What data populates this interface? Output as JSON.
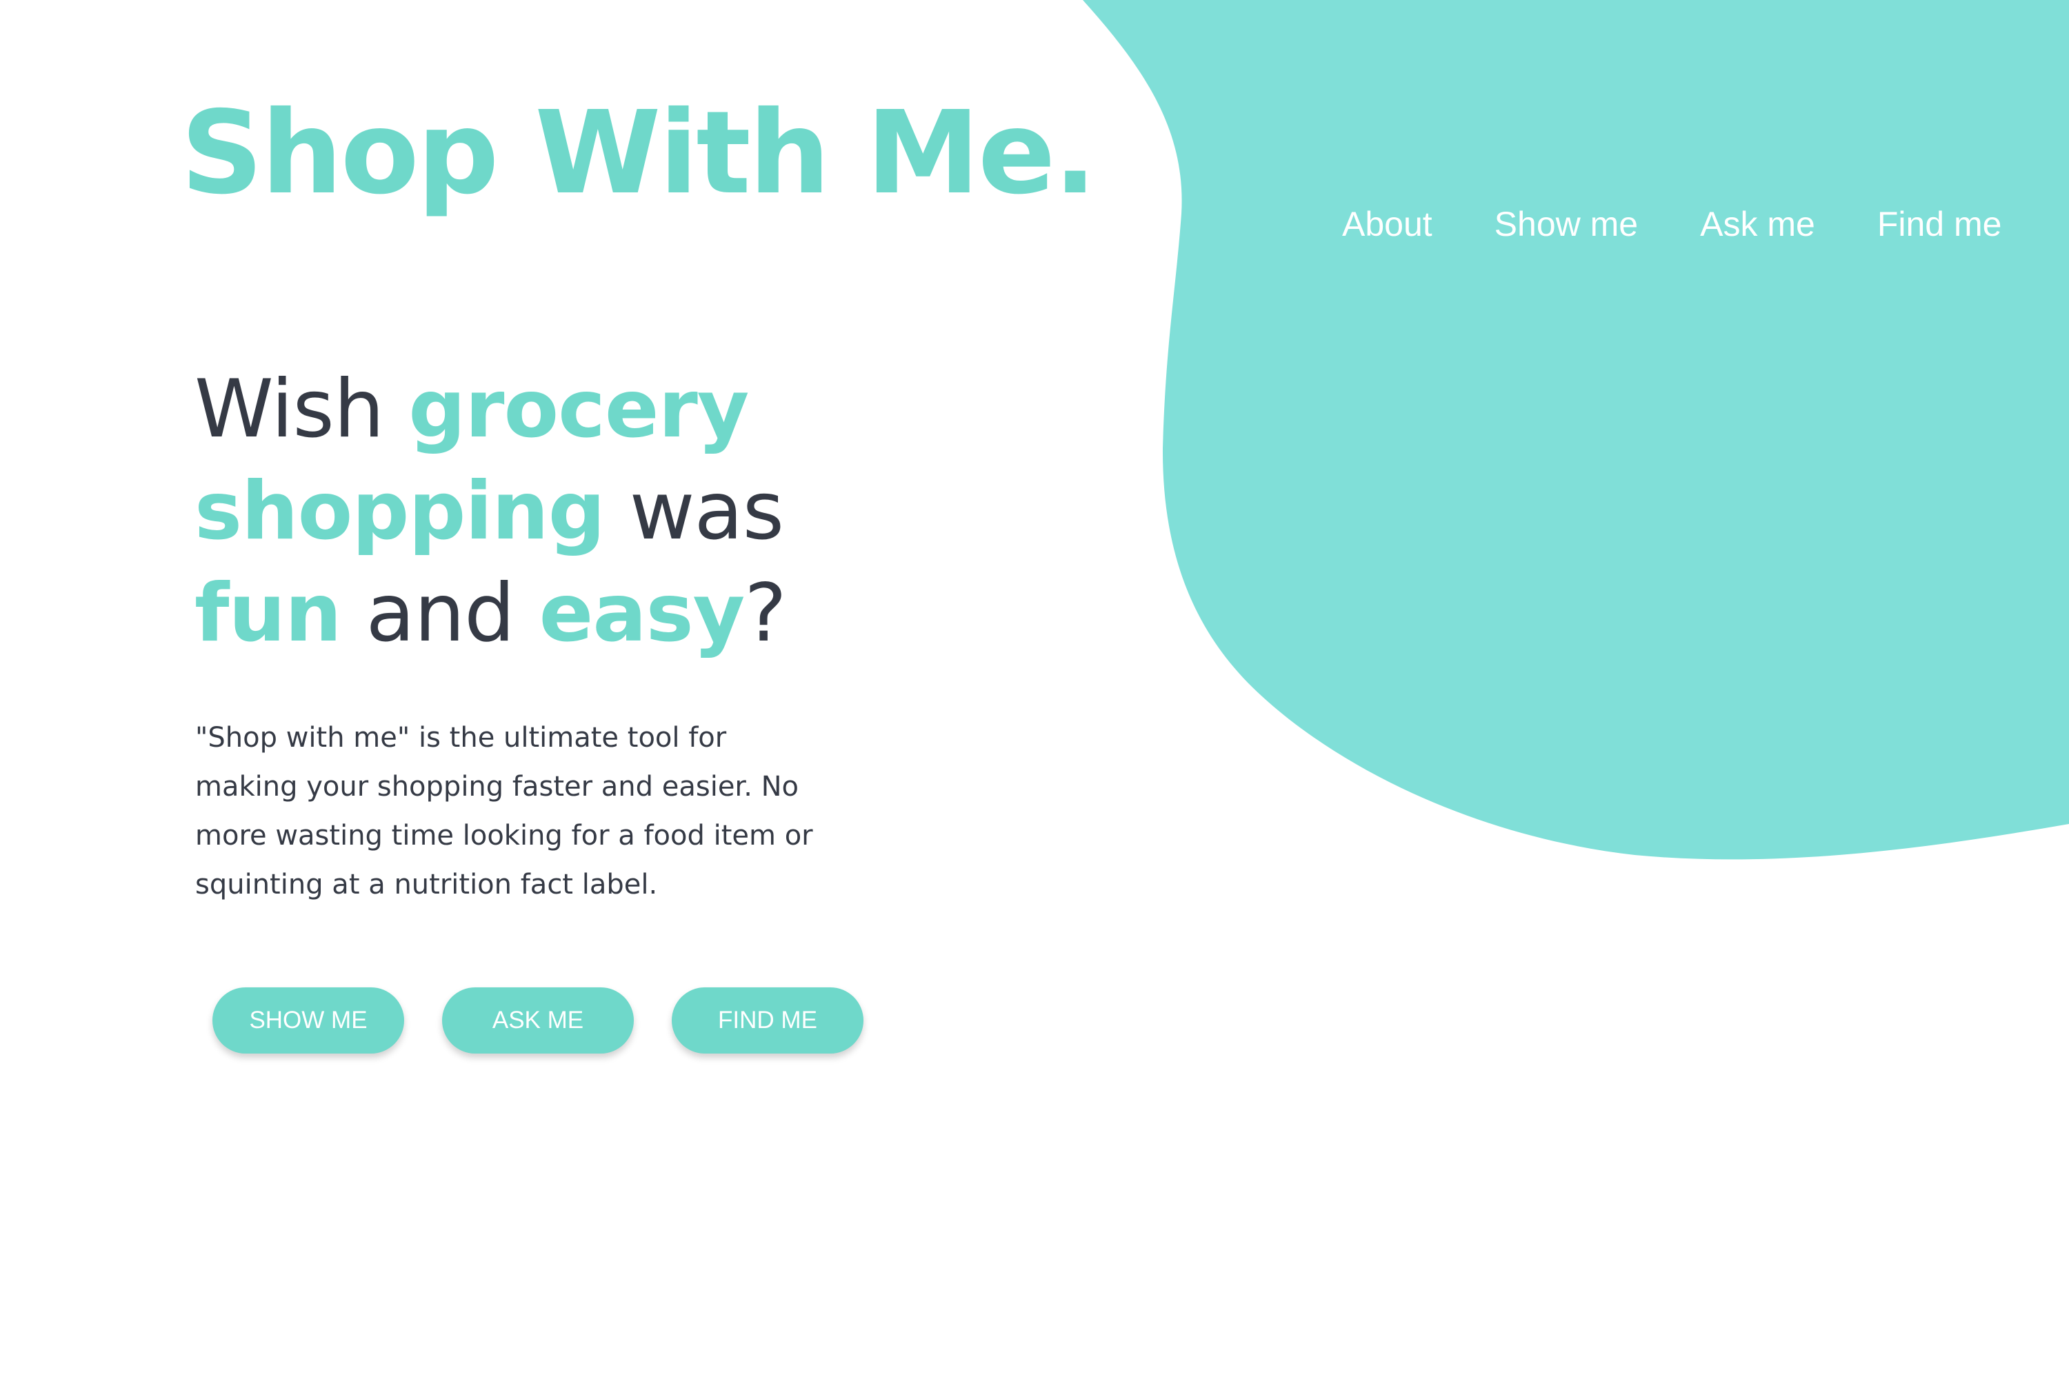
{
  "brand": {
    "name": "Shop With Me.",
    "accent_color": "#6fd8ca",
    "blob_color": "#80dfd8",
    "text_color": "#353a45"
  },
  "nav": {
    "items": [
      {
        "label": "About"
      },
      {
        "label": "Show me"
      },
      {
        "label": "Ask me"
      },
      {
        "label": "Find me"
      }
    ]
  },
  "hero": {
    "headline": {
      "w1": "Wish",
      "w2": "grocery",
      "w3": "shopping",
      "w4": "was",
      "w5": "fun",
      "w6": "and",
      "w7": "easy",
      "w8": "?"
    },
    "description": "\"Shop with me\" is the ultimate tool for making your shopping faster and easier. No more wasting time looking for a food item or squinting at a nutrition fact label."
  },
  "buttons": {
    "show": "SHOW ME",
    "ask": "ASK ME",
    "find": "FIND ME"
  }
}
